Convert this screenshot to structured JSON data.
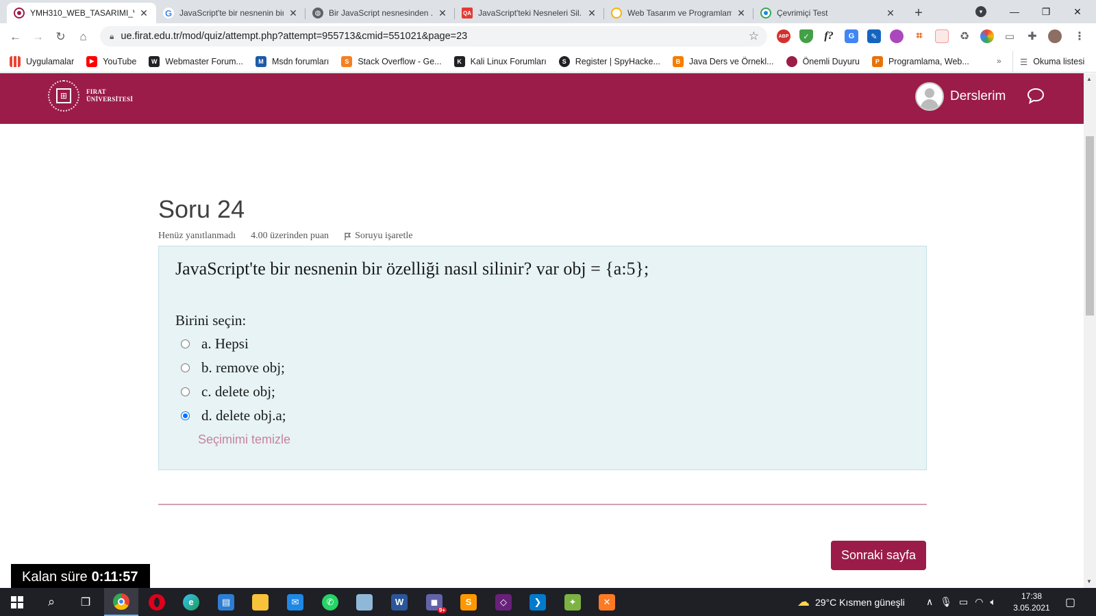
{
  "browser": {
    "tabs": [
      {
        "title": "YMH310_WEB_TASARIMI_V...",
        "favicon": "firat-icon",
        "color": "#9b1c48",
        "active": true
      },
      {
        "title": "JavaScript'te bir nesnenin bir ...",
        "favicon": "google-icon",
        "color": "#4285f4",
        "active": false
      },
      {
        "title": "Bir JavaScript nesnesinden ...",
        "favicon": "globe-icon",
        "color": "#5f6368",
        "active": false
      },
      {
        "title": "JavaScript'teki Nesneleri Sil...",
        "favicon": "qa-icon",
        "color": "#e53935",
        "active": false
      },
      {
        "title": "Web Tasarım ve Programlam...",
        "favicon": "web-icon",
        "color": "#f4b400",
        "active": false
      },
      {
        "title": "Çevrimiçi Test",
        "favicon": "test-icon",
        "color": "#34a853",
        "active": false
      }
    ],
    "url": "ue.firat.edu.tr/mod/quiz/attempt.php?attempt=955713&cmid=551021&page=23",
    "bookmarks": [
      {
        "label": "Uygulamalar",
        "icon": "apps-grid-icon",
        "color": "#4285f4"
      },
      {
        "label": "YouTube",
        "icon": "youtube-icon",
        "color": "#ff0000"
      },
      {
        "label": "Webmaster Forum...",
        "icon": "webmaster-icon",
        "color": "#202124"
      },
      {
        "label": "Msdn forumları",
        "icon": "msdn-icon",
        "color": "#1e5aa8"
      },
      {
        "label": "Stack Overflow - Ge...",
        "icon": "stackoverflow-icon",
        "color": "#f48024"
      },
      {
        "label": "Kali Linux Forumları",
        "icon": "kali-icon",
        "color": "#202124"
      },
      {
        "label": "Register | SpyHacke...",
        "icon": "spyhacker-icon",
        "color": "#202124"
      },
      {
        "label": "Java Ders ve Örnekl...",
        "icon": "blogger-icon",
        "color": "#f57d00"
      },
      {
        "label": "Önemli Duyuru",
        "icon": "firat-icon",
        "color": "#9b1c48"
      },
      {
        "label": "Programlama, Web...",
        "icon": "programlama-icon",
        "color": "#e8710a"
      }
    ],
    "bookmarks_more": "»",
    "reading_list": "Okuma listesi"
  },
  "site": {
    "logo_line1": "FIRAT",
    "logo_line2": "ÜNİVERSİTESİ",
    "courses_label": "Derslerim",
    "brand_color": "#9b1c48"
  },
  "quiz": {
    "title": "Soru 24",
    "status": "Henüz yanıtlanmadı",
    "points": "4.00 üzerinden puan",
    "flag_label": "Soruyu işaretle",
    "question": "JavaScript'te bir nesnenin bir özelliği nasıl silinir? var obj = {a:5};",
    "prompt": "Birini seçin:",
    "options": [
      {
        "label": "a. Hepsi",
        "selected": false
      },
      {
        "label": "b. remove obj;",
        "selected": false
      },
      {
        "label": "c. delete obj;",
        "selected": false
      },
      {
        "label": "d. delete obj.a;",
        "selected": true
      }
    ],
    "clear_label": "Seçimimi temizle",
    "next_label": "Sonraki sayfa",
    "timer_label": "Kalan süre",
    "timer_value": "0:11:57"
  },
  "taskbar": {
    "weather": "29°C  Kısmen güneşli",
    "time": "17:38",
    "date": "3.05.2021",
    "mail_badge": "9+"
  }
}
